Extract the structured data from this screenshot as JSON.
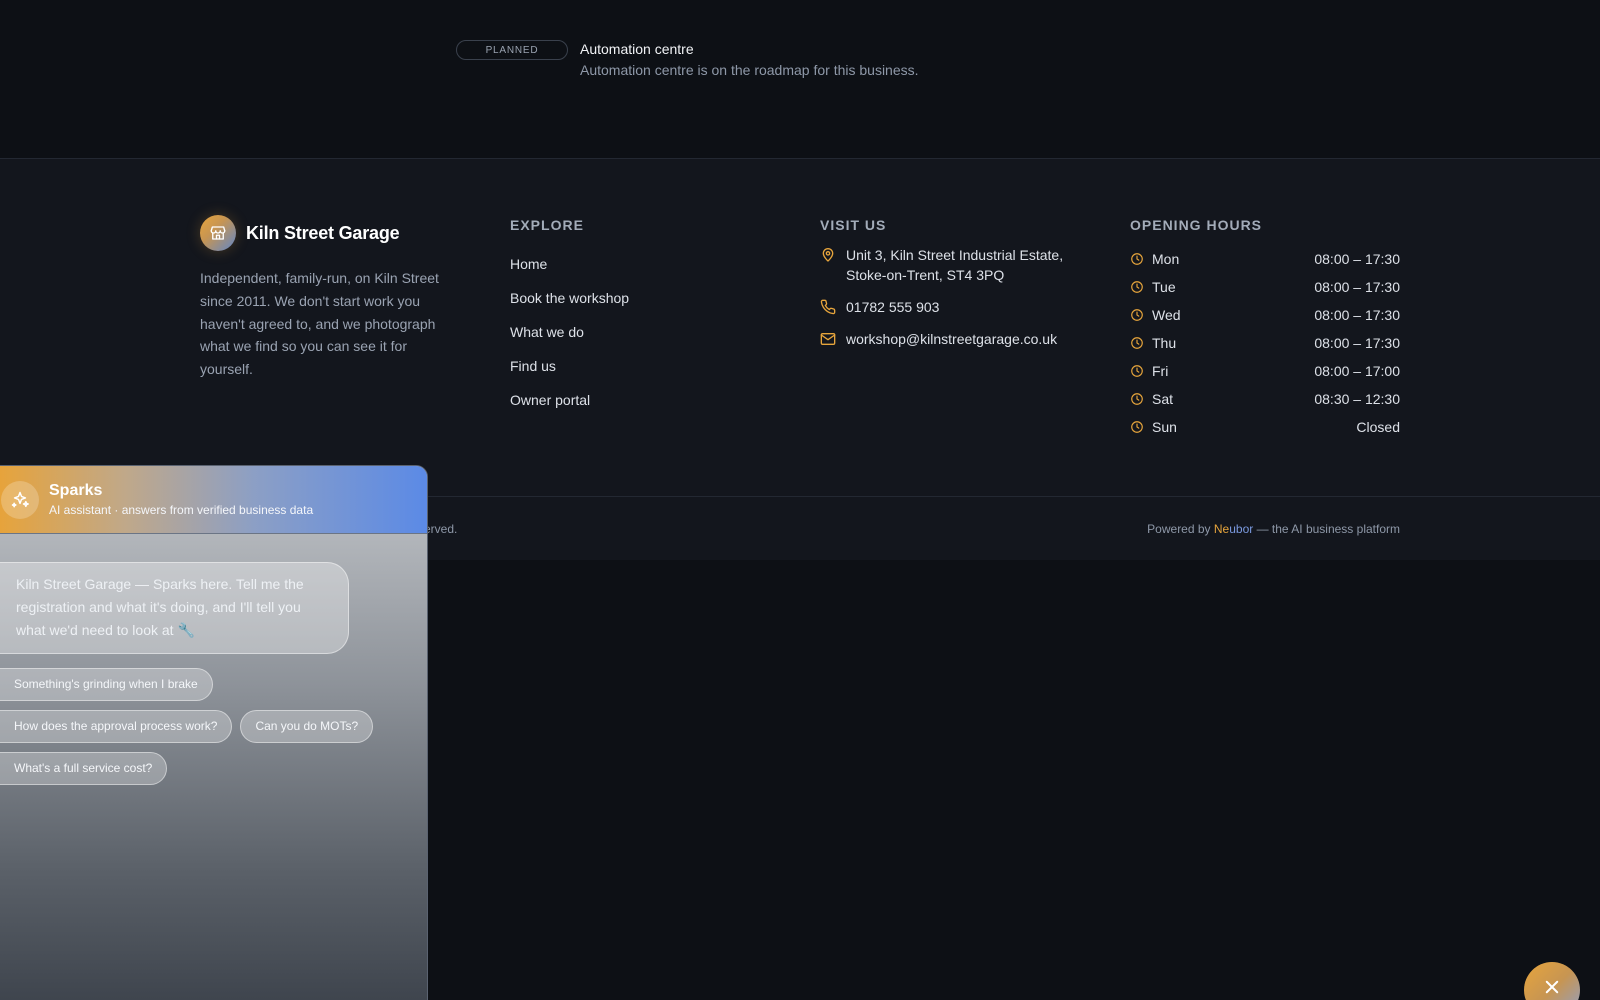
{
  "planned": {
    "badge": "PLANNED",
    "title": "Automation centre",
    "description": "Automation centre is on the roadmap for this business."
  },
  "brand": {
    "name": "Kiln Street Garage",
    "description": "Independent, family-run, on Kiln Street since 2011. We don't start work you haven't agreed to, and we photograph what we find so you can see it for yourself.",
    "logo_icon": "storefront-icon"
  },
  "explore": {
    "heading": "EXPLORE",
    "links": [
      "Home",
      "Book the workshop",
      "What we do",
      "Find us",
      "Owner portal"
    ]
  },
  "visit": {
    "heading": "VISIT US",
    "address": "Unit 3, Kiln Street Industrial Estate, Stoke-on-Trent, ST4 3PQ",
    "phone": "01782 555 903",
    "email": "workshop@kilnstreetgarage.co.uk"
  },
  "hours": {
    "heading": "OPENING HOURS",
    "rows": [
      {
        "day": "Mon",
        "time": "08:00 – 17:30"
      },
      {
        "day": "Tue",
        "time": "08:00 – 17:30"
      },
      {
        "day": "Wed",
        "time": "08:00 – 17:30"
      },
      {
        "day": "Thu",
        "time": "08:00 – 17:30"
      },
      {
        "day": "Fri",
        "time": "08:00 – 17:00"
      },
      {
        "day": "Sat",
        "time": "08:30 – 12:30"
      },
      {
        "day": "Sun",
        "time": "Closed"
      }
    ]
  },
  "footer": {
    "copyright_fragment": "erved.",
    "powered_prefix": "Powered by ",
    "powered_brand_a": "Ne",
    "powered_brand_b": "ubor",
    "powered_suffix": " — the AI business platform"
  },
  "chat": {
    "title": "Sparks",
    "subtitle": "AI assistant · answers from verified business data",
    "message": "Kiln Street Garage — Sparks here. Tell me the registration and what it's doing, and I'll tell you what we'd need to look at 🔧",
    "suggestions": [
      "Something's grinding when I brake",
      "How does the approval process work?",
      "Can you do MOTs?",
      "What's a full service cost?"
    ]
  },
  "colors": {
    "accent": "#e7a53c",
    "brand_blue": "#5b8ae6",
    "background": "#0d1015",
    "footer_bg": "#13161d"
  }
}
